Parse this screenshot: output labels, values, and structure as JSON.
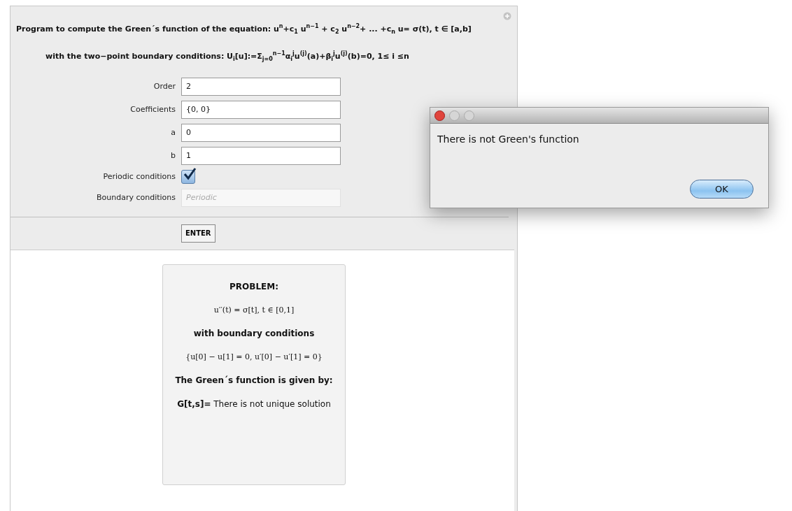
{
  "header": {
    "equation": "Program to compute the Green´s  function of the equation:  u$^{n}$+c$_{1}$ u$^{n−1}$ + c$_{2}$ u$^{n−2}$+ ... +c$_{n}$ u= σ(t),  t ∈ [a,b]",
    "boundary": "with the two−point boundary conditions:  U$_{i}$[u]:=Σ$_{j=0}$$^{n−1}$α$_{i}$$^{j}$u$^{(j)}$(a)+β$_{i}$$^{j}$u$^{(j)}$(b)=0,  1≤ i ≤n"
  },
  "form": [
    {
      "kind": "text",
      "label": "Order",
      "value": "2",
      "disabled": false
    },
    {
      "kind": "text",
      "label": "Coefficients",
      "value": "{0, 0}",
      "disabled": false
    },
    {
      "kind": "text",
      "label": "a",
      "value": "0",
      "disabled": false
    },
    {
      "kind": "text",
      "label": "b",
      "value": "1",
      "disabled": false
    },
    {
      "kind": "checkbox",
      "label": "Periodic conditions",
      "checked": true
    },
    {
      "kind": "text",
      "label": "Boundary conditions",
      "placeholder": "Periodic",
      "disabled": true
    }
  ],
  "enter_button": "ENTER",
  "result": {
    "lines": [
      {
        "kind": "heading",
        "text": "PROBLEM:"
      },
      {
        "kind": "math",
        "text": "u′′(t) = σ[t],    t ∈ [0,1]"
      },
      {
        "kind": "heading",
        "text": "with boundary conditions"
      },
      {
        "kind": "math",
        "text": "{u[0] − u[1] = 0, u′[0] − u′[1] = 0}"
      },
      {
        "kind": "heading",
        "text": "The Green´s function is given by:"
      },
      {
        "kind": "answer",
        "text": "**G[t,s]=** There is not unique solution"
      }
    ]
  },
  "dialog": {
    "message": "There is not Green's function",
    "button": "OK"
  }
}
